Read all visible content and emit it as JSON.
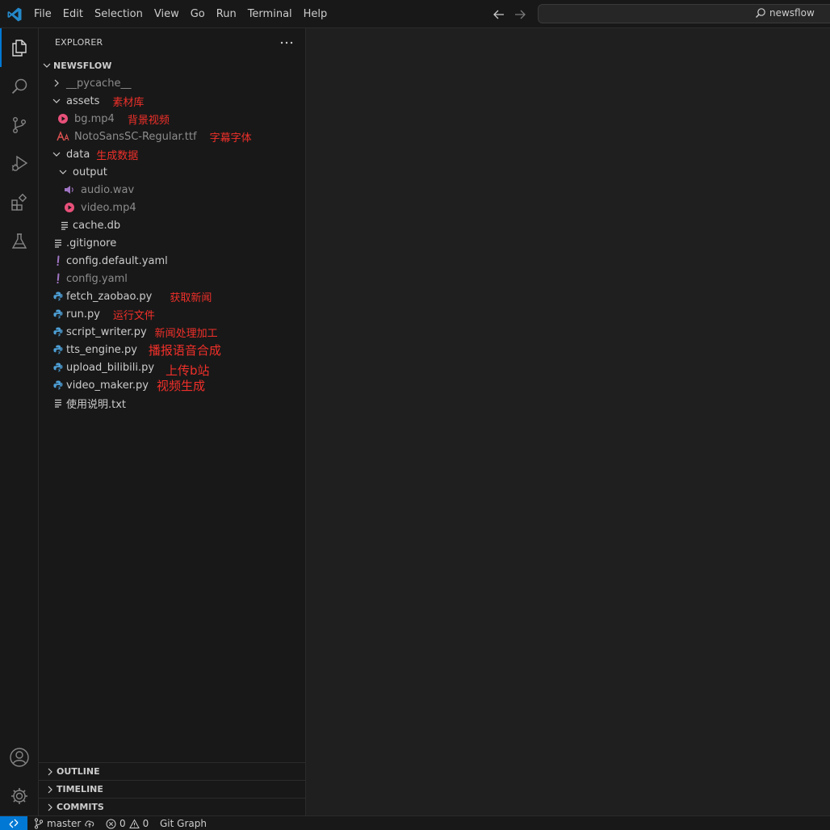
{
  "menu": [
    "File",
    "Edit",
    "Selection",
    "View",
    "Go",
    "Run",
    "Terminal",
    "Help"
  ],
  "search": {
    "text": "newsflow"
  },
  "sidebar": {
    "title": "EXPLORER"
  },
  "tree": {
    "root": "NEWSFLOW",
    "items": [
      {
        "label": "__pycache__",
        "dim": true
      },
      {
        "label": "assets",
        "note": "素材库"
      },
      {
        "label": "bg.mp4",
        "dim": true,
        "note": "背景视频"
      },
      {
        "label": "NotoSansSC-Regular.ttf",
        "dim": true,
        "note": "字幕字体"
      },
      {
        "label": "data",
        "note": "生成数据"
      },
      {
        "label": "output"
      },
      {
        "label": "audio.wav",
        "dim": true
      },
      {
        "label": "video.mp4",
        "dim": true
      },
      {
        "label": "cache.db"
      },
      {
        "label": ".gitignore"
      },
      {
        "label": "config.default.yaml"
      },
      {
        "label": "config.yaml",
        "dim": true
      },
      {
        "label": "fetch_zaobao.py",
        "note": "获取新闻"
      },
      {
        "label": "run.py",
        "note": "运行文件"
      },
      {
        "label": "script_writer.py",
        "note": "新闻处理加工"
      },
      {
        "label": "tts_engine.py",
        "note": "播报语音合成"
      },
      {
        "label": "upload_bilibili.py",
        "note": "上传b站"
      },
      {
        "label": "video_maker.py",
        "note": "视频生成"
      },
      {
        "label": "使用说明.txt"
      }
    ]
  },
  "panels": [
    "OUTLINE",
    "TIMELINE",
    "COMMITS"
  ],
  "status": {
    "branch": "master",
    "errors": "0",
    "warnings": "0",
    "git_graph": "Git Graph"
  },
  "colors": {
    "accent": "#0078d4",
    "annotation": "#f0302a",
    "python": "#4d9fd6",
    "yaml": "#a074c4",
    "video": "#e8507a",
    "font_icon": "#e05252"
  }
}
